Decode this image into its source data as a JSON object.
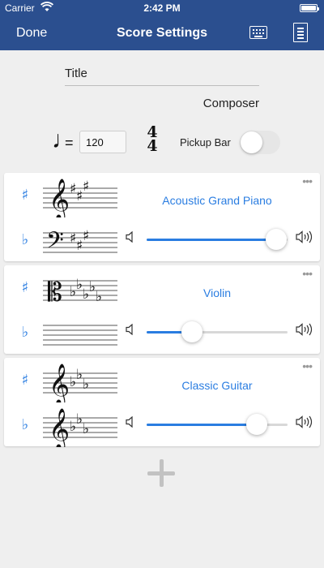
{
  "status": {
    "carrier": "Carrier",
    "time": "2:42 PM"
  },
  "nav": {
    "done_label": "Done",
    "title": "Score Settings"
  },
  "score": {
    "title_placeholder": "Title",
    "composer": "Composer",
    "tempo_value": "120",
    "time_signature": {
      "top": "4",
      "bottom": "4"
    },
    "pickup_label": "Pickup Bar",
    "pickup_enabled": false
  },
  "instruments": [
    {
      "name": "Acoustic Grand Piano",
      "top_clef": "treble",
      "top_key": "3 sharps",
      "bottom_clef": "bass",
      "bottom_key": "3 sharps",
      "volume": 0.92
    },
    {
      "name": "Violin",
      "top_clef": "alto",
      "top_key": "5 flats",
      "bottom_clef": "none",
      "bottom_key": "none",
      "volume": 0.32
    },
    {
      "name": "Classic Guitar",
      "top_clef": "treble",
      "top_key": "3 flats",
      "bottom_clef": "treble",
      "bottom_key": "3 flats",
      "volume": 0.78
    }
  ],
  "colors": {
    "nav_bg": "#2b4f8f",
    "accent": "#2a7de1",
    "page_bg": "#efefef"
  },
  "icons": {
    "sharp": "♯",
    "flat": "♭",
    "more": "•••",
    "quarter_note": "♩",
    "equals": "=",
    "treble_clef": "𝄞",
    "bass_clef": "𝄢",
    "alto_clef": "𝄡"
  }
}
